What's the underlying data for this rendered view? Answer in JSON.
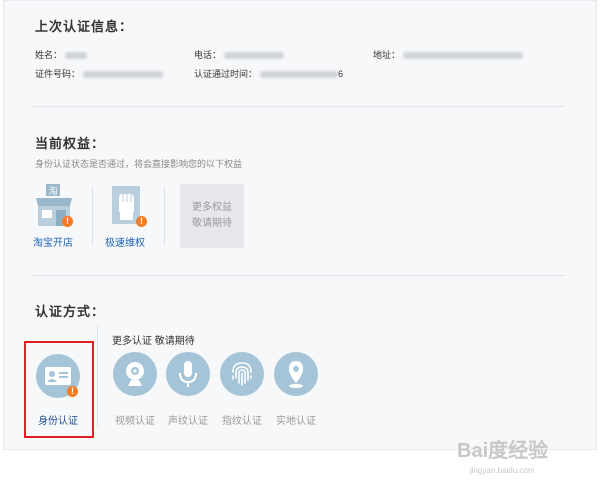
{
  "last_info": {
    "title": "上次认证信息：",
    "name_label": "姓名：",
    "phone_label": "电话：",
    "address_label": "地址：",
    "id_label": "证件号码：",
    "time_label": "认证通过时间：",
    "time_suffix": "6"
  },
  "benefits": {
    "title": "当前权益：",
    "hint": "身份认证状态是否通过，将会直接影响您的以下权益",
    "items": [
      {
        "label": "淘宝开店",
        "icon": "shop-icon"
      },
      {
        "label": "极速维权",
        "icon": "fist-icon"
      }
    ],
    "more_line1": "更多权益",
    "more_line2": "敬请期待"
  },
  "methods": {
    "title": "认证方式：",
    "more_text": "更多认证  敬请期待",
    "items": [
      {
        "label": "身份认证",
        "icon": "id-card-icon"
      },
      {
        "label": "视频认证",
        "icon": "webcam-icon"
      },
      {
        "label": "声纹认证",
        "icon": "microphone-icon"
      },
      {
        "label": "指纹认证",
        "icon": "fingerprint-icon"
      },
      {
        "label": "实地认证",
        "icon": "location-pin-icon"
      }
    ]
  },
  "colors": {
    "accent": "#1f64b5",
    "circle": "#a5c4d8",
    "badge": "#f57c1f",
    "highlight": "#e02020"
  },
  "watermark": {
    "brand": "Bai度经验",
    "url": "jingyan.baidu.com"
  }
}
